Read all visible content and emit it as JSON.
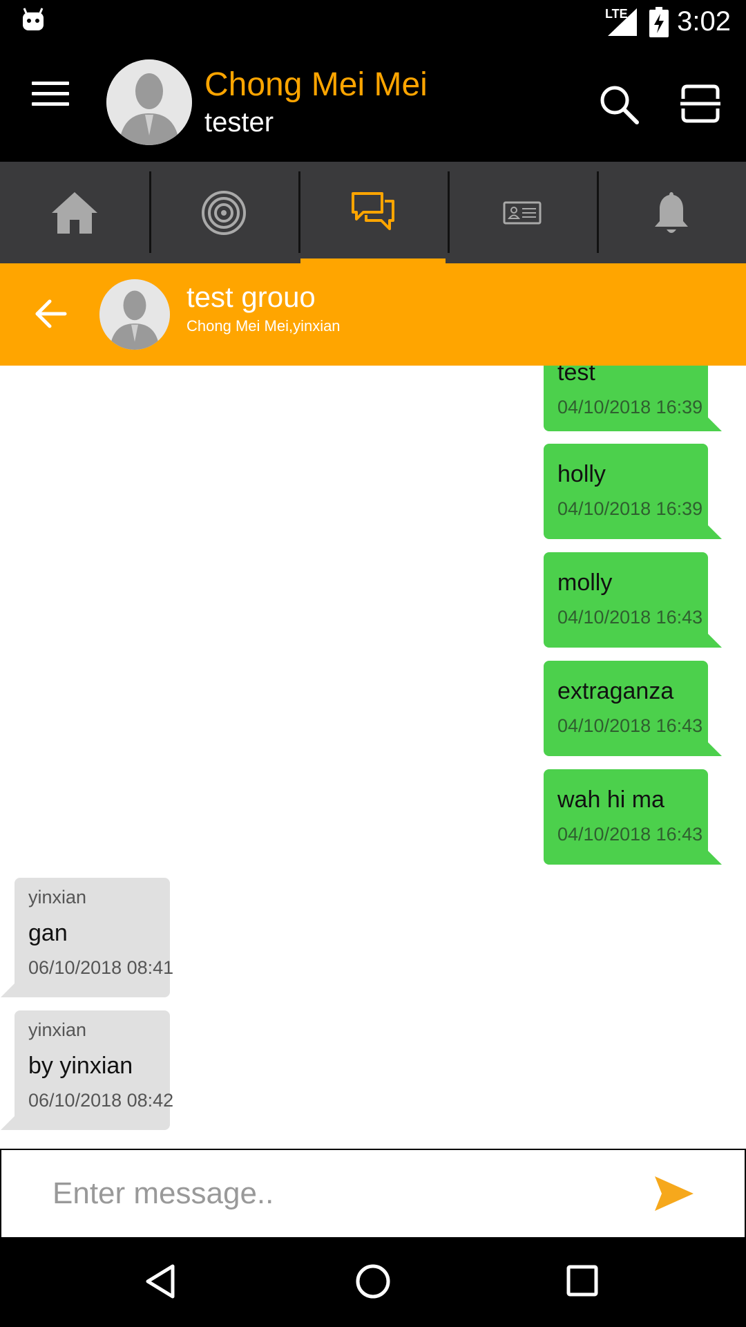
{
  "status_bar": {
    "time": "3:02",
    "network": "LTE"
  },
  "header": {
    "user_name": "Chong Mei Mei",
    "user_status": "tester"
  },
  "tabs": [
    {
      "icon": "home-icon"
    },
    {
      "icon": "radar-icon"
    },
    {
      "icon": "chat-icon",
      "active": true
    },
    {
      "icon": "contact-card-icon"
    },
    {
      "icon": "bell-icon"
    }
  ],
  "conversation": {
    "title": "test grouo",
    "members": "Chong Mei Mei,yinxian"
  },
  "messages": [
    {
      "direction": "sent",
      "text": "test",
      "time": "04/10/2018 16:39"
    },
    {
      "direction": "sent",
      "text": "holly",
      "time": "04/10/2018 16:39"
    },
    {
      "direction": "sent",
      "text": "molly",
      "time": "04/10/2018 16:43"
    },
    {
      "direction": "sent",
      "text": "extraganza",
      "time": "04/10/2018 16:43"
    },
    {
      "direction": "sent",
      "text": "wah hi ma",
      "time": "04/10/2018 16:43"
    },
    {
      "direction": "received",
      "sender": "yinxian",
      "text": "gan",
      "time": "06/10/2018 08:41"
    },
    {
      "direction": "received",
      "sender": "yinxian",
      "text": "by yinxian",
      "time": "06/10/2018 08:42"
    }
  ],
  "composer": {
    "placeholder": "Enter message..",
    "value": ""
  },
  "colors": {
    "accent": "#FFA500",
    "sent_bubble": "#4cd04c",
    "received_bubble": "#e0e0e0",
    "tabbar": "#3a3a3c"
  }
}
